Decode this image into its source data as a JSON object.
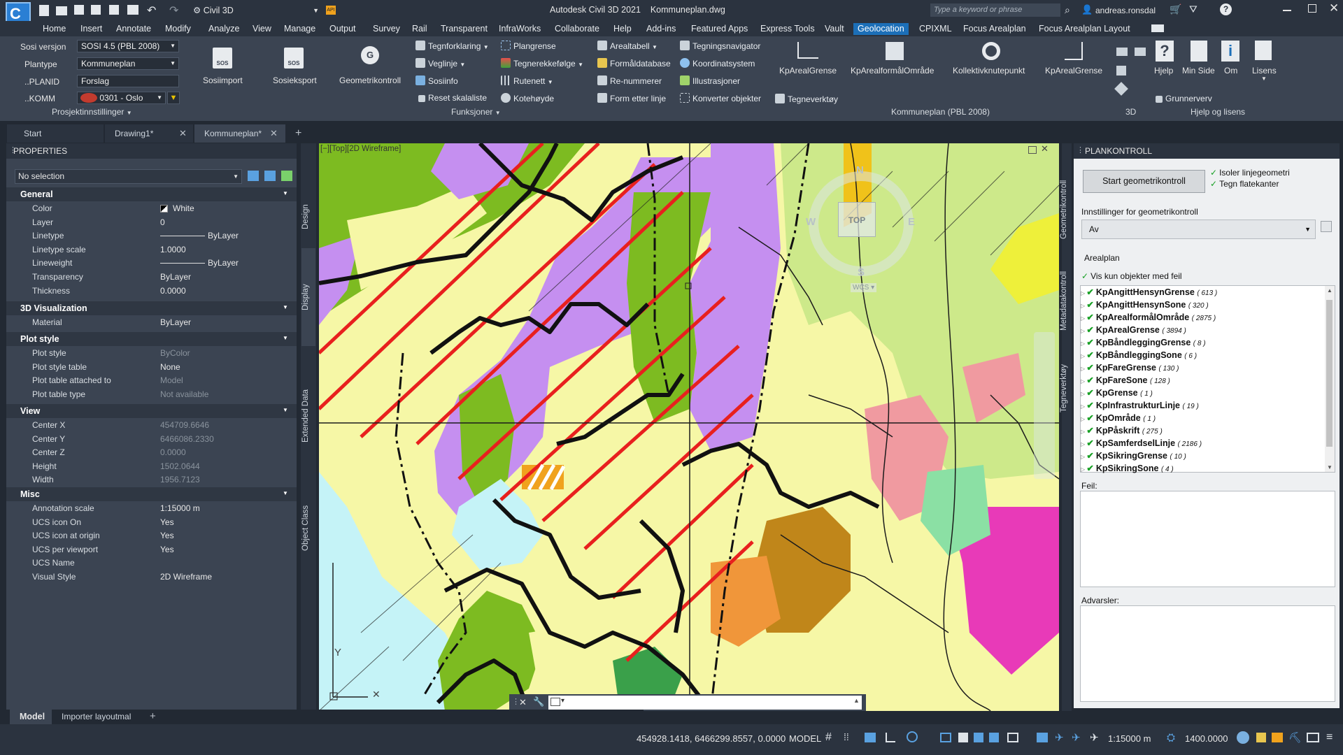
{
  "title_bar": {
    "workspace": "Civil 3D",
    "app_title": "Autodesk Civil 3D 2021",
    "file_name": "Kommuneplan.dwg",
    "search_placeholder": "Type a keyword or phrase",
    "user": "andreas.ronsdal"
  },
  "menu": {
    "items": [
      "Home",
      "Insert",
      "Annotate",
      "Modify",
      "Analyze",
      "View",
      "Manage",
      "Output",
      "Survey",
      "Rail",
      "Transparent",
      "InfraWorks",
      "Collaborate",
      "Help",
      "Add-ins",
      "Featured Apps",
      "Express Tools",
      "Vault",
      "Geolocation",
      "CPIXML",
      "Focus Arealplan",
      "Focus Arealplan Layout"
    ],
    "active": "Geolocation"
  },
  "project_settings": {
    "sosi_label": "Sosi versjon",
    "sosi_value": "SOSI 4.5 (PBL 2008)",
    "plantype_label": "Plantype",
    "plantype_value": "Kommuneplan",
    "planid_label": "..PLANID",
    "planid_value": "Forslag",
    "komm_label": "..KOMM",
    "komm_value": "0301 - Oslo",
    "group_label": "Prosjektinnstillinger"
  },
  "ribbon": {
    "sosiimport": "Sosiimport",
    "sosieksport": "Sosieksport",
    "geometrikontroll": "Geometrikontroll",
    "tegnforklaring": "Tegnforklaring",
    "veglinje": "Veglinje",
    "sosiinfo": "Sosiinfo",
    "reset_skalaliste": "Reset skalaliste",
    "plangrense": "Plangrense",
    "tegnerekkefolge": "Tegnerekkefølge",
    "rutenett": "Rutenett",
    "kotehoyde": "Kotehøyde",
    "funksjoner": "Funksjoner",
    "arealtabell": "Arealtabell",
    "formaldatabase": "Formåldatabase",
    "re_nummerer": "Re-nummerer",
    "form_etter_linje": "Form etter linje",
    "tegningsnavigator": "Tegningsnavigator",
    "koordinatsystem": "Koordinatsystem",
    "illustrasjoner": "Illustrasjoner",
    "konverter_objekter": "Konverter objekter",
    "kp_areal_grense": "KpArealGrense",
    "kp_arealformal_omrade": "KpArealformålOmråde",
    "kollektivknutepunkt": "Kollektivknutepunkt",
    "kp_areal_grense_2": "KpArealGrense",
    "tegneverktoy": "Tegneverktøy",
    "kommuneplan_group": "Kommuneplan (PBL 2008)",
    "three_d": "3D",
    "hjelp": "Hjelp",
    "min_side": "Min Side",
    "om": "Om",
    "lisens": "Lisens",
    "grunnerverv": "Grunnerverv",
    "hjelp_og_lisens": "Hjelp og lisens"
  },
  "doc_tabs": [
    "Start",
    "Drawing1*",
    "Kommuneplan*"
  ],
  "properties": {
    "title": "PROPERTIES",
    "selection": "No selection",
    "sections": {
      "general": "General",
      "viz": "3D Visualization",
      "plot": "Plot style",
      "view": "View",
      "misc": "Misc"
    },
    "general": [
      {
        "name": "Color",
        "value": "White"
      },
      {
        "name": "Layer",
        "value": "0"
      },
      {
        "name": "Linetype",
        "value": "ByLayer"
      },
      {
        "name": "Linetype scale",
        "value": "1.0000"
      },
      {
        "name": "Lineweight",
        "value": "ByLayer"
      },
      {
        "name": "Transparency",
        "value": "ByLayer"
      },
      {
        "name": "Thickness",
        "value": "0.0000"
      }
    ],
    "viz": [
      {
        "name": "Material",
        "value": "ByLayer"
      }
    ],
    "plot": [
      {
        "name": "Plot style",
        "value": "ByColor"
      },
      {
        "name": "Plot style table",
        "value": "None"
      },
      {
        "name": "Plot table attached to",
        "value": "Model"
      },
      {
        "name": "Plot table type",
        "value": "Not available"
      }
    ],
    "view": [
      {
        "name": "Center X",
        "value": "454709.6646"
      },
      {
        "name": "Center Y",
        "value": "6466086.2330"
      },
      {
        "name": "Center Z",
        "value": "0.0000"
      },
      {
        "name": "Height",
        "value": "1502.0644"
      },
      {
        "name": "Width",
        "value": "1956.7123"
      }
    ],
    "misc": [
      {
        "name": "Annotation scale",
        "value": "1:15000 m"
      },
      {
        "name": "UCS icon On",
        "value": "Yes"
      },
      {
        "name": "UCS icon at origin",
        "value": "Yes"
      },
      {
        "name": "UCS per viewport",
        "value": "Yes"
      },
      {
        "name": "UCS Name",
        "value": ""
      },
      {
        "name": "Visual Style",
        "value": "2D Wireframe"
      }
    ],
    "side_tabs": [
      "Design",
      "Display",
      "Extended Data",
      "Object Class"
    ]
  },
  "viewport": {
    "label": "[−][Top][2D Wireframe]",
    "compass_n": "N",
    "compass_s": "S",
    "compass_w": "W",
    "compass_e": "E",
    "top": "TOP",
    "wcs": "WCS",
    "axis_y": "Y"
  },
  "plankontroll": {
    "title": "PLANKONTROLL",
    "start_button": "Start geometrikontroll",
    "isoler": "Isoler linjegeometri",
    "tegn": "Tegn flatekanter",
    "innstillinger_label": "Innstillinger for geometrikontroll",
    "innstillinger_value": "Av",
    "arealplan": "Arealplan",
    "vis_kun": "Vis kun objekter med feil",
    "feil": "Feil:",
    "advarsler": "Advarsler:",
    "side_tabs": [
      "Geometrikontroll",
      "Metadatakontroll",
      "Tegneverktøy"
    ],
    "items": [
      {
        "name": "KpAngittHensynGrense",
        "count": "( 613 )"
      },
      {
        "name": "KpAngittHensynSone",
        "count": "( 320 )"
      },
      {
        "name": "KpArealformålOmråde",
        "count": "( 2875 )"
      },
      {
        "name": "KpArealGrense",
        "count": "( 3894 )"
      },
      {
        "name": "KpBåndleggingGrense",
        "count": "( 8 )"
      },
      {
        "name": "KpBåndleggingSone",
        "count": "( 6 )"
      },
      {
        "name": "KpFareGrense",
        "count": "( 130 )"
      },
      {
        "name": "KpFareSone",
        "count": "( 128 )"
      },
      {
        "name": "KpGrense",
        "count": "( 1 )"
      },
      {
        "name": "KpInfrastrukturLinje",
        "count": "( 19 )"
      },
      {
        "name": "KpOmråde",
        "count": "( 1 )"
      },
      {
        "name": "KpPåskrift",
        "count": "( 275 )"
      },
      {
        "name": "KpSamferdselLinje",
        "count": "( 2186 )"
      },
      {
        "name": "KpSikringGrense",
        "count": "( 10 )"
      },
      {
        "name": "KpSikringSone",
        "count": "( 4 )"
      }
    ]
  },
  "layout_tabs": [
    "Model",
    "Importer layoutmal"
  ],
  "status": {
    "coords": "454928.1418, 6466299.8557, 0.0000",
    "model": "MODEL",
    "scale": "1:15000 m",
    "elevation": "1400.0000"
  },
  "colors": {
    "accent": "#1c6fb8",
    "check": "#18a025",
    "water": "#c5f3f7",
    "residential": "#f6f7a6",
    "purple": "#c58ff0",
    "green": "#7dbb21",
    "light_green": "#cde98a",
    "red_stripe": "#e8201e"
  }
}
